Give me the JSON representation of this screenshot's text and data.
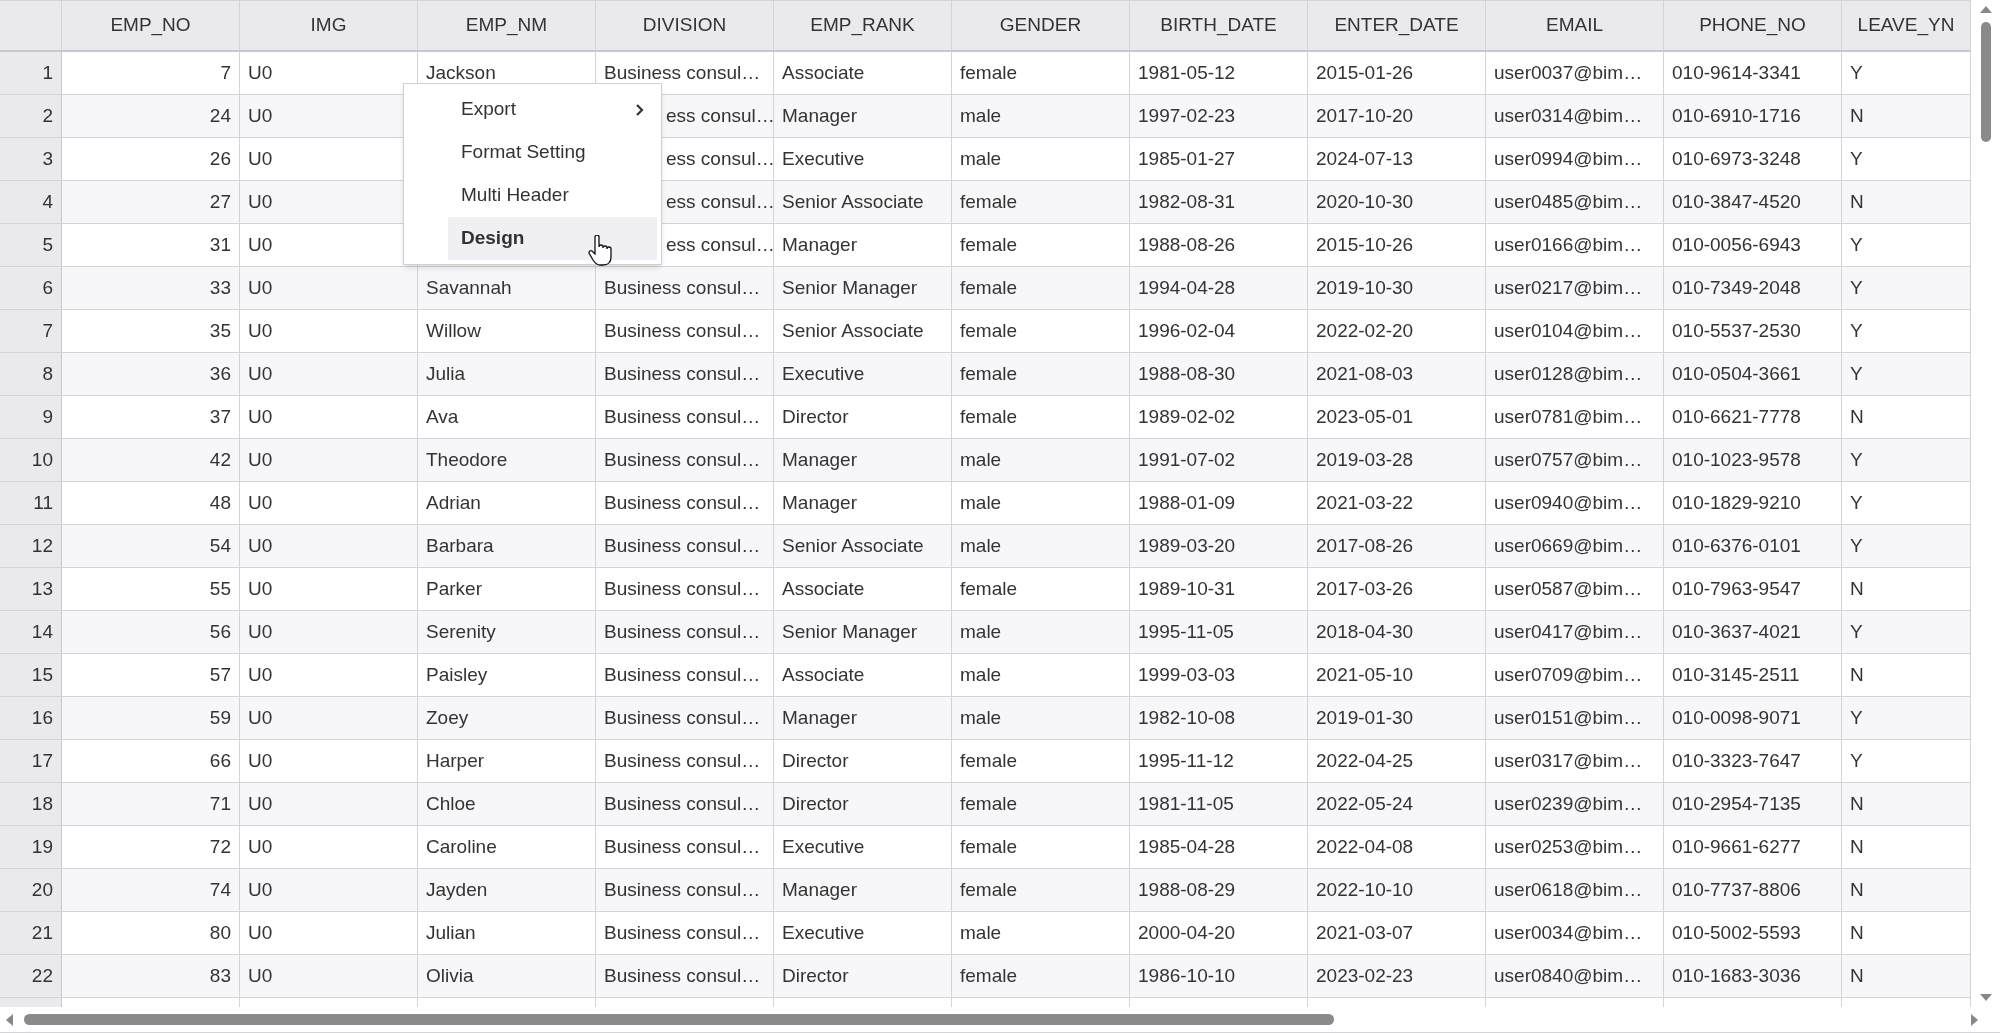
{
  "columns": [
    "EMP_NO",
    "IMG",
    "EMP_NM",
    "DIVISION",
    "EMP_RANK",
    "GENDER",
    "BIRTH_DATE",
    "ENTER_DATE",
    "EMAIL",
    "PHONE_NO",
    "LEAVE_YN"
  ],
  "rows": [
    {
      "no": "1",
      "emp_no": "7",
      "img": "U0",
      "emp_nm": "Jackson",
      "division": "Business consul…",
      "rank": "Associate",
      "gender": "female",
      "birth": "1981-05-12",
      "enter": "2015-01-26",
      "email": "user0037@bim…",
      "phone": "010-9614-3341",
      "leave": "Y",
      "under_menu": false
    },
    {
      "no": "2",
      "emp_no": "24",
      "img": "U0",
      "division": "ess consul…",
      "rank": "Manager",
      "gender": "male",
      "birth": "1997-02-23",
      "enter": "2017-10-20",
      "email": "user0314@bim…",
      "phone": "010-6910-1716",
      "leave": "N",
      "under_menu": true
    },
    {
      "no": "3",
      "emp_no": "26",
      "img": "U0",
      "division": "ess consul…",
      "rank": "Executive",
      "gender": "male",
      "birth": "1985-01-27",
      "enter": "2024-07-13",
      "email": "user0994@bim…",
      "phone": "010-6973-3248",
      "leave": "Y",
      "under_menu": true
    },
    {
      "no": "4",
      "emp_no": "27",
      "img": "U0",
      "division": "ess consul…",
      "rank": "Senior Associate",
      "gender": "female",
      "birth": "1982-08-31",
      "enter": "2020-10-30",
      "email": "user0485@bim…",
      "phone": "010-3847-4520",
      "leave": "N",
      "under_menu": true
    },
    {
      "no": "5",
      "emp_no": "31",
      "img": "U0",
      "division": "ess consul…",
      "rank": "Manager",
      "gender": "female",
      "birth": "1988-08-26",
      "enter": "2015-10-26",
      "email": "user0166@bim…",
      "phone": "010-0056-6943",
      "leave": "Y",
      "under_menu": true
    },
    {
      "no": "6",
      "emp_no": "33",
      "img": "U0",
      "emp_nm": "Savannah",
      "division": "Business consul…",
      "rank": "Senior Manager",
      "gender": "female",
      "birth": "1994-04-28",
      "enter": "2019-10-30",
      "email": "user0217@bim…",
      "phone": "010-7349-2048",
      "leave": "Y",
      "under_menu": false
    },
    {
      "no": "7",
      "emp_no": "35",
      "img": "U0",
      "emp_nm": "Willow",
      "division": "Business consul…",
      "rank": "Senior Associate",
      "gender": "female",
      "birth": "1996-02-04",
      "enter": "2022-02-20",
      "email": "user0104@bim…",
      "phone": "010-5537-2530",
      "leave": "Y",
      "under_menu": false
    },
    {
      "no": "8",
      "emp_no": "36",
      "img": "U0",
      "emp_nm": "Julia",
      "division": "Business consul…",
      "rank": "Executive",
      "gender": "female",
      "birth": "1988-08-30",
      "enter": "2021-08-03",
      "email": "user0128@bim…",
      "phone": "010-0504-3661",
      "leave": "Y",
      "under_menu": false
    },
    {
      "no": "9",
      "emp_no": "37",
      "img": "U0",
      "emp_nm": "Ava",
      "division": "Business consul…",
      "rank": "Director",
      "gender": "female",
      "birth": "1989-02-02",
      "enter": "2023-05-01",
      "email": "user0781@bim…",
      "phone": "010-6621-7778",
      "leave": "N",
      "under_menu": false
    },
    {
      "no": "10",
      "emp_no": "42",
      "img": "U0",
      "emp_nm": "Theodore",
      "division": "Business consul…",
      "rank": "Manager",
      "gender": "male",
      "birth": "1991-07-02",
      "enter": "2019-03-28",
      "email": "user0757@bim…",
      "phone": "010-1023-9578",
      "leave": "Y",
      "under_menu": false
    },
    {
      "no": "11",
      "emp_no": "48",
      "img": "U0",
      "emp_nm": "Adrian",
      "division": "Business consul…",
      "rank": "Manager",
      "gender": "male",
      "birth": "1988-01-09",
      "enter": "2021-03-22",
      "email": "user0940@bim…",
      "phone": "010-1829-9210",
      "leave": "Y",
      "under_menu": false
    },
    {
      "no": "12",
      "emp_no": "54",
      "img": "U0",
      "emp_nm": "Barbara",
      "division": "Business consul…",
      "rank": "Senior Associate",
      "gender": "male",
      "birth": "1989-03-20",
      "enter": "2017-08-26",
      "email": "user0669@bim…",
      "phone": "010-6376-0101",
      "leave": "Y",
      "under_menu": false
    },
    {
      "no": "13",
      "emp_no": "55",
      "img": "U0",
      "emp_nm": "Parker",
      "division": "Business consul…",
      "rank": "Associate",
      "gender": "female",
      "birth": "1989-10-31",
      "enter": "2017-03-26",
      "email": "user0587@bim…",
      "phone": "010-7963-9547",
      "leave": "N",
      "under_menu": false
    },
    {
      "no": "14",
      "emp_no": "56",
      "img": "U0",
      "emp_nm": "Serenity",
      "division": "Business consul…",
      "rank": "Senior Manager",
      "gender": "male",
      "birth": "1995-11-05",
      "enter": "2018-04-30",
      "email": "user0417@bim…",
      "phone": "010-3637-4021",
      "leave": "Y",
      "under_menu": false
    },
    {
      "no": "15",
      "emp_no": "57",
      "img": "U0",
      "emp_nm": "Paisley",
      "division": "Business consul…",
      "rank": "Associate",
      "gender": "male",
      "birth": "1999-03-03",
      "enter": "2021-05-10",
      "email": "user0709@bim…",
      "phone": "010-3145-2511",
      "leave": "N",
      "under_menu": false
    },
    {
      "no": "16",
      "emp_no": "59",
      "img": "U0",
      "emp_nm": "Zoey",
      "division": "Business consul…",
      "rank": "Manager",
      "gender": "male",
      "birth": "1982-10-08",
      "enter": "2019-01-30",
      "email": "user0151@bim…",
      "phone": "010-0098-9071",
      "leave": "Y",
      "under_menu": false
    },
    {
      "no": "17",
      "emp_no": "66",
      "img": "U0",
      "emp_nm": "Harper",
      "division": "Business consul…",
      "rank": "Director",
      "gender": "female",
      "birth": "1995-11-12",
      "enter": "2022-04-25",
      "email": "user0317@bim…",
      "phone": "010-3323-7647",
      "leave": "Y",
      "under_menu": false
    },
    {
      "no": "18",
      "emp_no": "71",
      "img": "U0",
      "emp_nm": "Chloe",
      "division": "Business consul…",
      "rank": "Director",
      "gender": "female",
      "birth": "1981-11-05",
      "enter": "2022-05-24",
      "email": "user0239@bim…",
      "phone": "010-2954-7135",
      "leave": "N",
      "under_menu": false
    },
    {
      "no": "19",
      "emp_no": "72",
      "img": "U0",
      "emp_nm": "Caroline",
      "division": "Business consul…",
      "rank": "Executive",
      "gender": "female",
      "birth": "1985-04-28",
      "enter": "2022-04-08",
      "email": "user0253@bim…",
      "phone": "010-9661-6277",
      "leave": "N",
      "under_menu": false
    },
    {
      "no": "20",
      "emp_no": "74",
      "img": "U0",
      "emp_nm": "Jayden",
      "division": "Business consul…",
      "rank": "Manager",
      "gender": "female",
      "birth": "1988-08-29",
      "enter": "2022-10-10",
      "email": "user0618@bim…",
      "phone": "010-7737-8806",
      "leave": "N",
      "under_menu": false
    },
    {
      "no": "21",
      "emp_no": "80",
      "img": "U0",
      "emp_nm": "Julian",
      "division": "Business consul…",
      "rank": "Executive",
      "gender": "male",
      "birth": "2000-04-20",
      "enter": "2021-03-07",
      "email": "user0034@bim…",
      "phone": "010-5002-5593",
      "leave": "N",
      "under_menu": false
    },
    {
      "no": "22",
      "emp_no": "83",
      "img": "U0",
      "emp_nm": "Olivia",
      "division": "Business consul…",
      "rank": "Director",
      "gender": "female",
      "birth": "1986-10-10",
      "enter": "2023-02-23",
      "email": "user0840@bim…",
      "phone": "010-1683-3036",
      "leave": "N",
      "under_menu": false
    }
  ],
  "context_menu": {
    "items": [
      {
        "label": "Export",
        "submenu": true,
        "selected": false
      },
      {
        "label": "Format Setting",
        "submenu": false,
        "selected": false
      },
      {
        "label": "Multi Header",
        "submenu": false,
        "selected": false
      },
      {
        "label": "Design",
        "submenu": false,
        "selected": true
      }
    ]
  }
}
